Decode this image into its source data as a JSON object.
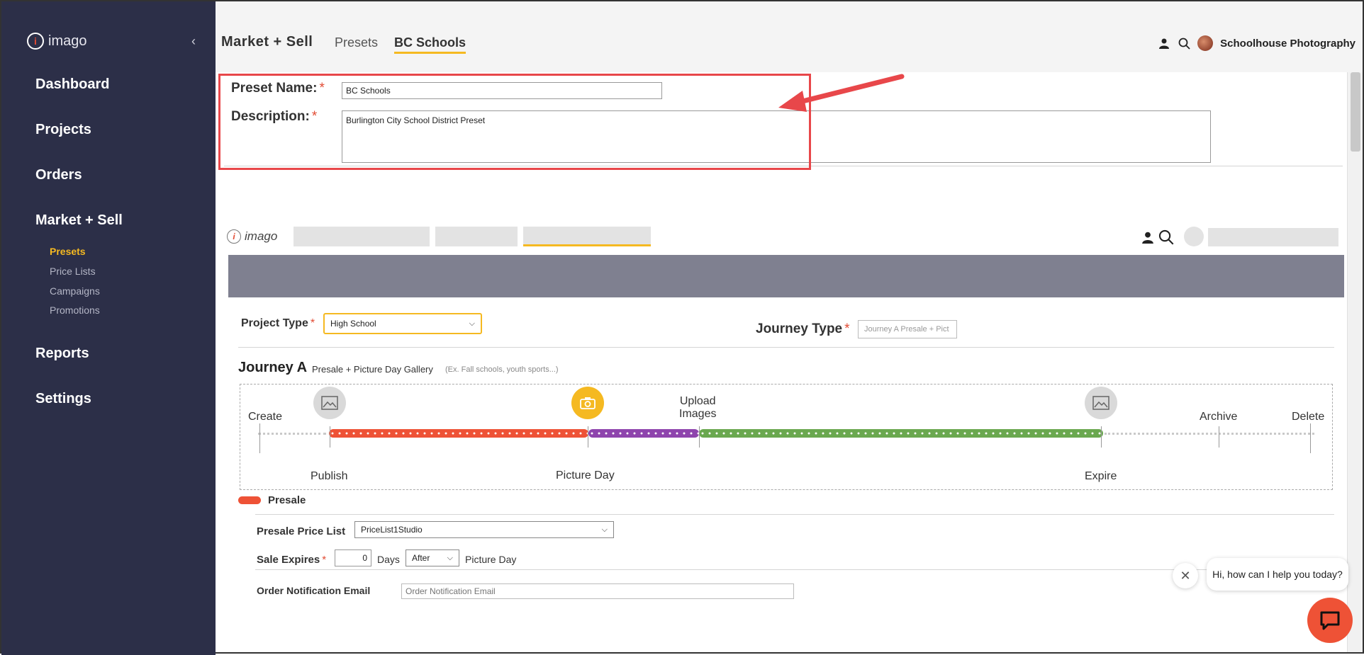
{
  "sidebar": {
    "logo_text": "imago",
    "nav": [
      {
        "label": "Dashboard"
      },
      {
        "label": "Projects"
      },
      {
        "label": "Orders"
      },
      {
        "label": "Market + Sell"
      },
      {
        "label": "Reports"
      },
      {
        "label": "Settings"
      }
    ],
    "sub_items": [
      {
        "label": "Presets"
      },
      {
        "label": "Price Lists"
      },
      {
        "label": "Campaigns"
      },
      {
        "label": "Promotions"
      }
    ]
  },
  "header": {
    "section": "Market + Sell",
    "tabs": [
      {
        "label": "Presets"
      },
      {
        "label": "BC Schools"
      }
    ],
    "account_name": "Schoolhouse Photography"
  },
  "form": {
    "preset_name_label": "Preset Name:",
    "preset_name_value": "BC Schools",
    "description_label": "Description:",
    "description_value": "Burlington City School District Preset",
    "required_mark": "*"
  },
  "preview": {
    "logo_text": "imago",
    "project_type_label": "Project Type",
    "project_type_value": "High School",
    "journey_type_label": "Journey Type",
    "journey_type_placeholder": "Journey A Presale + Pict",
    "journey_title": "Journey A",
    "journey_subtitle": "Presale + Picture Day Gallery",
    "journey_example": "(Ex. Fall schools, youth sports...)",
    "timeline": {
      "create": "Create",
      "publish": "Publish",
      "picture_day": "Picture Day",
      "upload_line1": "Upload",
      "upload_line2": "Images",
      "expire": "Expire",
      "archive": "Archive",
      "delete": "Delete"
    },
    "colors": {
      "presale": "#ee5236",
      "picture_day": "#8e44ad",
      "gallery": "#6aa84f",
      "accent": "#f5b921"
    },
    "presale_section_label": "Presale",
    "presale_price_list_label": "Presale Price List",
    "presale_price_list_value": "PriceList1Studio",
    "sale_expires_label": "Sale Expires",
    "sale_expires_value": "0",
    "days_label": "Days",
    "after_value": "After",
    "picture_day_text": "Picture Day",
    "order_email_label": "Order Notification Email",
    "order_email_placeholder": "Order Notification Email"
  },
  "chat": {
    "message": "Hi, how can I help you today?"
  }
}
